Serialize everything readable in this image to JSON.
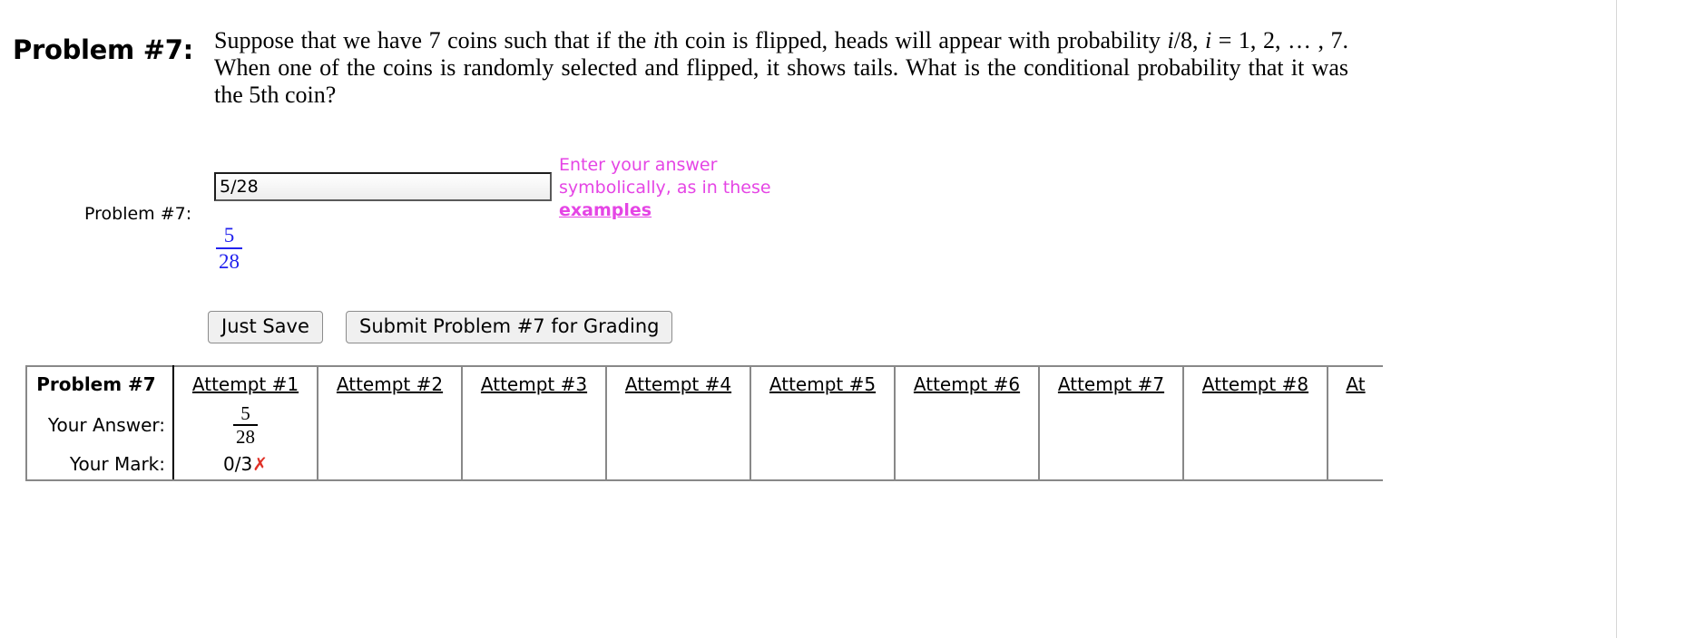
{
  "problem": {
    "label": "Problem #7:",
    "text_part1": "Suppose that we have 7 coins such that if the ",
    "text_i1": "i",
    "text_part2": "th coin is flipped, heads will appear with probability ",
    "text_i2": "i",
    "text_part3": "/8, ",
    "text_i3": "i",
    "text_part4": " = 1, 2, … , 7. When one of the coins is randomly selected and flipped, it shows tails. What is the conditional probability that it was the 5th coin?"
  },
  "answer_area": {
    "row_label": "Problem #7:",
    "input_value": "5/28",
    "input_placeholder": "",
    "hint_line1": "Enter your answer",
    "hint_line2": "symbolically, as in these",
    "hint_link": "examples",
    "hint_color": "#e545e5",
    "preview": {
      "numerator": "5",
      "denominator": "28",
      "color": "#2222ee"
    }
  },
  "buttons": {
    "just_save": "Just Save",
    "submit": "Submit Problem #7 for Grading"
  },
  "attempts_table": {
    "corner_label": "Problem #7",
    "row_labels": {
      "answer": "Your Answer:",
      "mark": "Your Mark:"
    },
    "columns": [
      {
        "header": "Attempt #1",
        "answer_numerator": "5",
        "answer_denominator": "28",
        "mark": "0/3",
        "mark_icon": "cross-icon",
        "mark_icon_glyph": "✗",
        "mark_icon_color": "#e03127"
      },
      {
        "header": "Attempt #2",
        "answer_numerator": "",
        "answer_denominator": "",
        "mark": "",
        "mark_icon": "",
        "mark_icon_glyph": "",
        "mark_icon_color": ""
      },
      {
        "header": "Attempt #3",
        "answer_numerator": "",
        "answer_denominator": "",
        "mark": "",
        "mark_icon": "",
        "mark_icon_glyph": "",
        "mark_icon_color": ""
      },
      {
        "header": "Attempt #4",
        "answer_numerator": "",
        "answer_denominator": "",
        "mark": "",
        "mark_icon": "",
        "mark_icon_glyph": "",
        "mark_icon_color": ""
      },
      {
        "header": "Attempt #5",
        "answer_numerator": "",
        "answer_denominator": "",
        "mark": "",
        "mark_icon": "",
        "mark_icon_glyph": "",
        "mark_icon_color": ""
      },
      {
        "header": "Attempt #6",
        "answer_numerator": "",
        "answer_denominator": "",
        "mark": "",
        "mark_icon": "",
        "mark_icon_glyph": "",
        "mark_icon_color": ""
      },
      {
        "header": "Attempt #7",
        "answer_numerator": "",
        "answer_denominator": "",
        "mark": "",
        "mark_icon": "",
        "mark_icon_glyph": "",
        "mark_icon_color": ""
      },
      {
        "header": "Attempt #8",
        "answer_numerator": "",
        "answer_denominator": "",
        "mark": "",
        "mark_icon": "",
        "mark_icon_glyph": "",
        "mark_icon_color": ""
      },
      {
        "header": "At",
        "answer_numerator": "",
        "answer_denominator": "",
        "mark": "",
        "mark_icon": "",
        "mark_icon_glyph": "",
        "mark_icon_color": ""
      }
    ]
  }
}
